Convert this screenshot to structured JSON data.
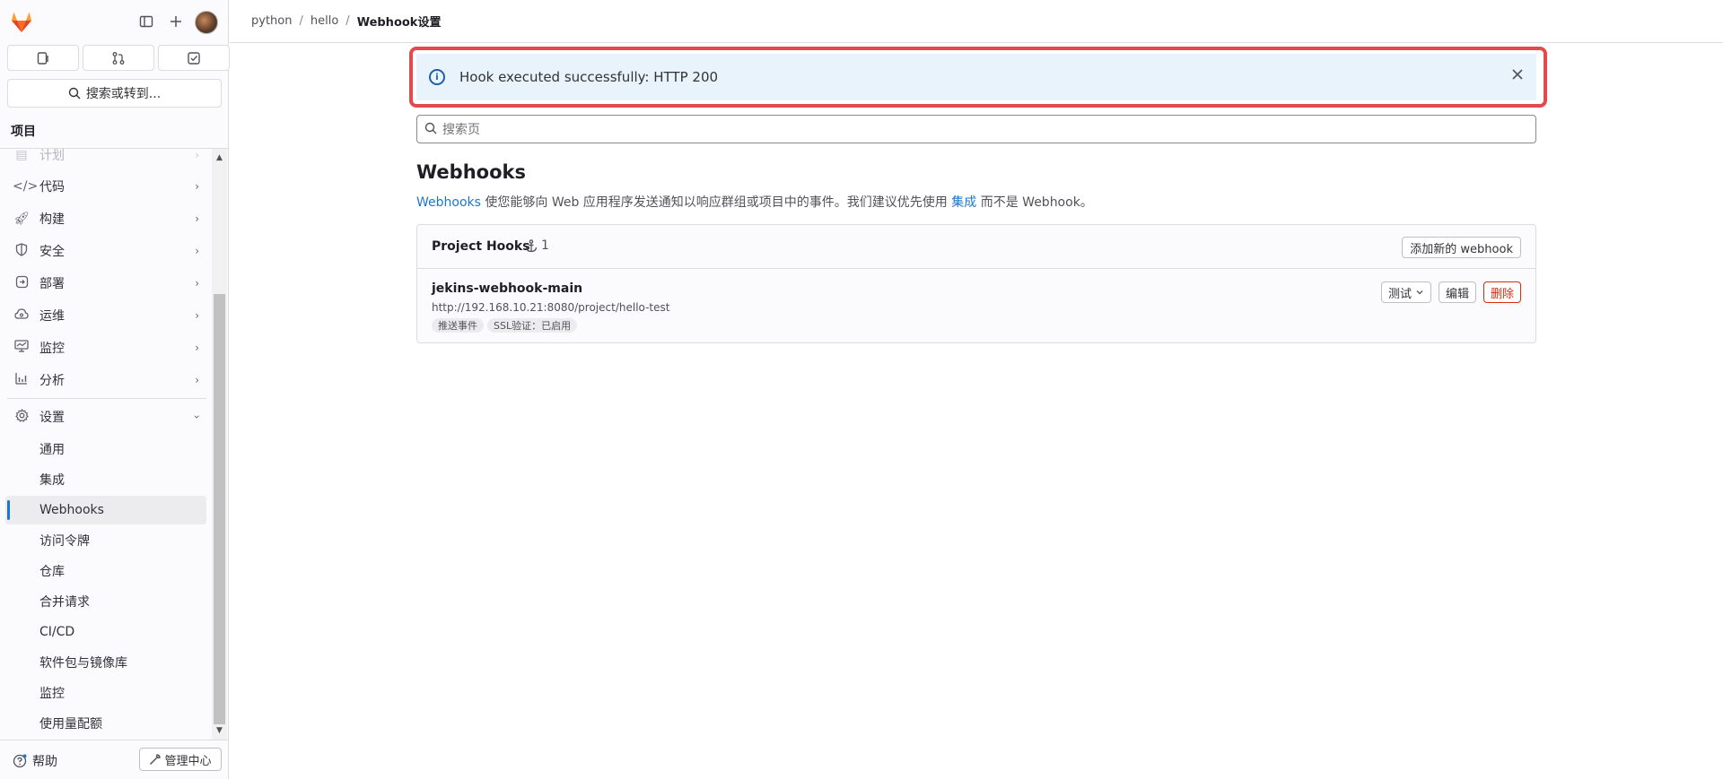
{
  "breadcrumb": [
    "python",
    "hello",
    "Webhook设置"
  ],
  "sidebar": {
    "search_label": "搜索或转到...",
    "section_title": "项目",
    "partial_item": "计划",
    "items": [
      {
        "label": "代码",
        "icon": "code-icon"
      },
      {
        "label": "构建",
        "icon": "rocket-icon"
      },
      {
        "label": "安全",
        "icon": "shield-icon"
      },
      {
        "label": "部署",
        "icon": "deploy-icon"
      },
      {
        "label": "运维",
        "icon": "cloud-icon"
      },
      {
        "label": "监控",
        "icon": "monitor-icon"
      },
      {
        "label": "分析",
        "icon": "chart-icon"
      }
    ],
    "settings_label": "设置",
    "sub_items": [
      "通用",
      "集成",
      "Webhooks",
      "访问令牌",
      "仓库",
      "合并请求",
      "CI/CD",
      "软件包与镜像库",
      "监控",
      "使用量配额"
    ],
    "active_sub": "Webhooks",
    "help_label": "帮助",
    "admin_label": "管理中心"
  },
  "alert": {
    "message": "Hook executed successfully: HTTP 200"
  },
  "page_search": {
    "placeholder": "搜索页"
  },
  "page": {
    "title": "Webhooks",
    "desc_link1": "Webhooks",
    "desc_text1": " 使您能够向 Web 应用程序发送通知以响应群组或项目中的事件。我们建议优先使用 ",
    "desc_link2": "集成",
    "desc_text2": " 而不是 Webhook。"
  },
  "card": {
    "title": "Project Hooks",
    "count": "1",
    "add_button": "添加新的 webhook",
    "hook": {
      "name": "jekins-webhook-main",
      "url": "http://192.168.10.21:8080/project/hello-test",
      "badges": [
        "推送事件",
        "SSL验证：已启用"
      ],
      "test_label": "测试",
      "edit_label": "编辑",
      "delete_label": "删除"
    }
  },
  "colors": {
    "accent": "#1f75cb",
    "danger": "#dd2b0e",
    "highlight": "#e5484d",
    "alert_bg": "#e9f3fc"
  }
}
